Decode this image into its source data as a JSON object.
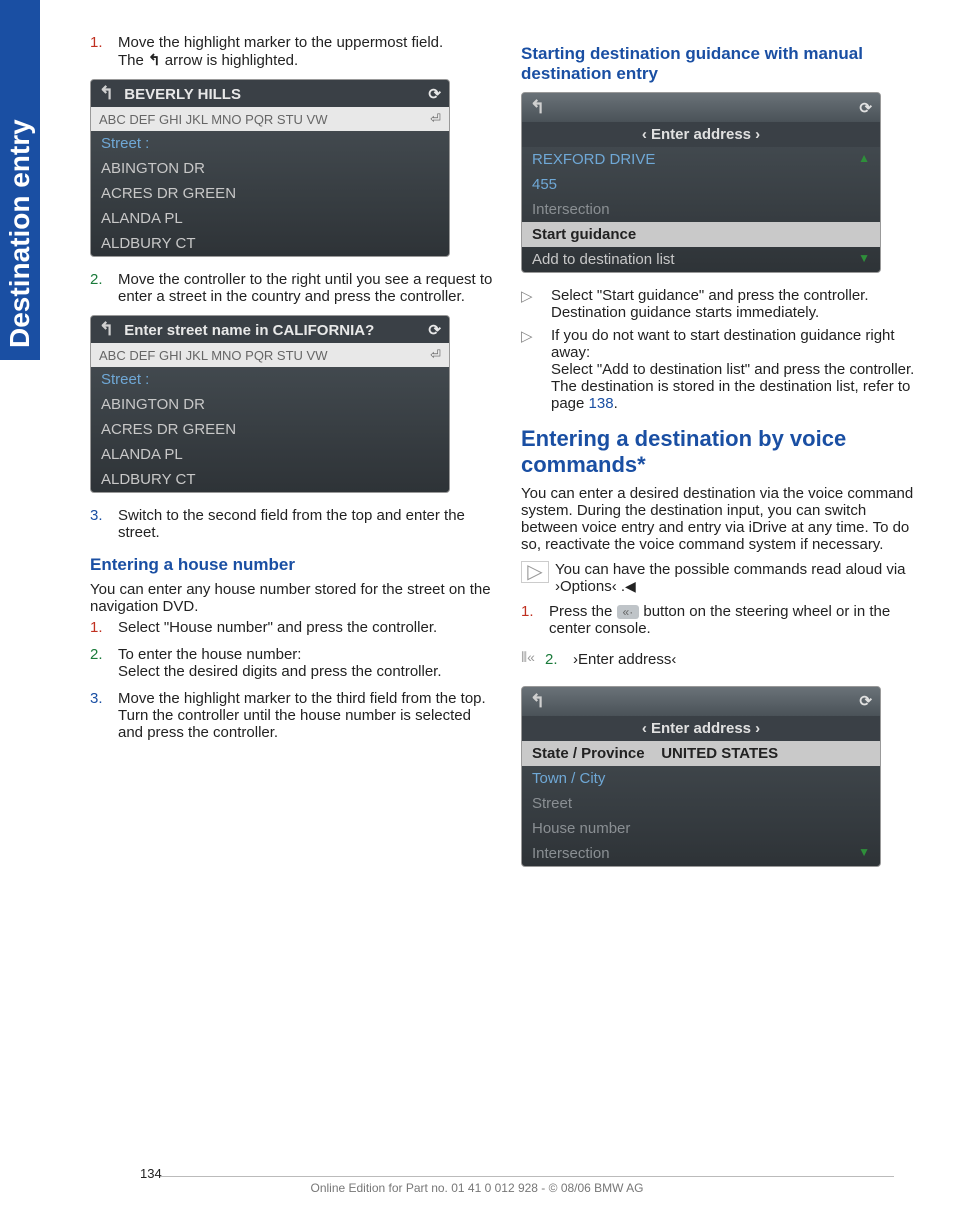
{
  "sideTab": "Destination entry",
  "left": {
    "step1": {
      "num": "1.",
      "line1": "Move the highlight marker to the uppermost field.",
      "line2a": "The ",
      "line2b": " arrow is highlighted."
    },
    "shot1": {
      "title": "BEVERLY HILLS",
      "abc": "ABC DEF GHI JKL MNO PQR STU VW",
      "streetLabel": "Street :",
      "rows": [
        "ABINGTON DR",
        "ACRES DR GREEN",
        "ALANDA PL",
        "ALDBURY CT"
      ]
    },
    "step2": {
      "num": "2.",
      "text": "Move the controller to the right until you see a request to enter a street in the country and press the controller."
    },
    "shot2": {
      "title": "Enter street name in CALIFORNIA?",
      "abc": "ABC DEF GHI JKL MNO PQR STU VW",
      "streetLabel": "Street :",
      "rows": [
        "ABINGTON DR",
        "ACRES DR GREEN",
        "ALANDA PL",
        "ALDBURY CT"
      ]
    },
    "step3": {
      "num": "3.",
      "text": "Switch to the second field from the top and enter the street."
    },
    "houseHeading": "Entering a house number",
    "houseIntro": "You can enter any house number stored for the street on the navigation DVD.",
    "hstep1": {
      "num": "1.",
      "text": "Select \"House number\" and press the controller."
    },
    "hstep2": {
      "num": "2.",
      "line1": "To enter the house number:",
      "line2": "Select the desired digits and press the controller."
    },
    "hstep3": {
      "num": "3.",
      "text": "Move the highlight marker to the third field from the top. Turn the controller until the house number is selected and press the controller."
    }
  },
  "right": {
    "startHeading": "Starting destination guidance with manual destination entry",
    "shot3": {
      "tab": "‹ Enter address ›",
      "rows": [
        "REXFORD DRIVE",
        "455",
        "Intersection"
      ],
      "sel": "Start guidance",
      "last": "Add to destination list"
    },
    "b1": {
      "line1": "Select \"Start guidance\" and press the controller.",
      "line2": "Destination guidance starts immediately."
    },
    "b2": {
      "line1": "If you do not want to start destination guidance right away:",
      "line2": "Select \"Add to destination list\" and press the controller.",
      "line3a": "The destination is stored in the destination list, refer to page ",
      "pageLink": "138",
      "line3b": "."
    },
    "voiceHeading": "Entering a destination by voice commands*",
    "voiceIntro": "You can enter a desired destination via the voice command system. During the destination input, you can switch between voice entry and entry via iDrive at any time. To do so, reactivate the voice command system if necessary.",
    "tip": {
      "a": "You can have the possible commands read aloud via ›Options‹ .",
      "end": "◀"
    },
    "vstep1": {
      "num": "1.",
      "a": "Press the ",
      "b": " button on the steering wheel or in the center console."
    },
    "vstep2": {
      "num": "2.",
      "text": "›Enter address‹"
    },
    "shot4": {
      "tab": "‹ Enter address ›",
      "selLabel": "State / Province",
      "selValue": "UNITED STATES",
      "rows": [
        "Town / City",
        "Street",
        "House number",
        "Intersection"
      ]
    }
  },
  "footer": {
    "page": "134",
    "text": "Online Edition for Part no. 01 41 0 012 928 - © 08/06 BMW AG"
  }
}
